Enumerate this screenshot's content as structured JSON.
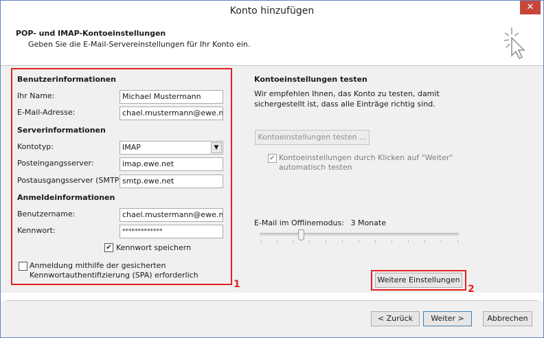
{
  "window": {
    "title": "Konto hinzufügen",
    "close_glyph": "✕"
  },
  "header": {
    "title": "POP- und IMAP-Kontoeinstellungen",
    "subtitle": "Geben Sie die E-Mail-Servereinstellungen für Ihr Konto ein.",
    "icon": "cursor-sparkle-icon"
  },
  "left": {
    "user_section": "Benutzerinformationen",
    "name_label": "Ihr Name:",
    "name_value": "Michael Mustermann",
    "email_label": "E-Mail-Adresse:",
    "email_value": "chael.mustermann@ewe.net",
    "server_section": "Serverinformationen",
    "account_type_label": "Kontotyp:",
    "account_type_value": "IMAP",
    "incoming_label": "Posteingangsserver:",
    "incoming_value": "imap.ewe.net",
    "outgoing_label": "Postausgangsserver (SMTP):",
    "outgoing_value": "smtp.ewe.net",
    "login_section": "Anmeldeinformationen",
    "username_label": "Benutzername:",
    "username_value": "chael.mustermann@ewe.net",
    "password_label": "Kennwort:",
    "password_value": "*************",
    "remember_label": "Kennwort speichern",
    "remember_checked": true,
    "spa_line1": "Anmeldung mithilfe der gesicherten",
    "spa_line2": "Kennwortauthentifizierung (SPA) erforderlich",
    "spa_checked": false
  },
  "right": {
    "test_title": "Kontoeinstellungen testen",
    "test_desc_line1": "Wir empfehlen Ihnen, das Konto zu testen, damit",
    "test_desc_line2": "sichergestellt ist, dass alle Einträge richtig sind.",
    "test_button": "Kontoeinstellungen testen ...",
    "auto_test_line1": "Kontoeinstellungen durch Klicken auf \"Weiter\"",
    "auto_test_line2": "automatisch testen",
    "auto_test_checked": true,
    "offline_label": "E-Mail im Offlinemodus:",
    "offline_value": "3 Monate",
    "more_settings_button": "Weitere Einstellungen"
  },
  "annotations": {
    "label1": "1",
    "label2": "2",
    "color": "#e42020"
  },
  "footer": {
    "back": "< Zurück",
    "next": "Weiter >",
    "cancel": "Abbrechen"
  },
  "colors": {
    "accent_border": "#3c7fb1",
    "window_border": "#5f84c6",
    "close_button": "#c7463a"
  }
}
